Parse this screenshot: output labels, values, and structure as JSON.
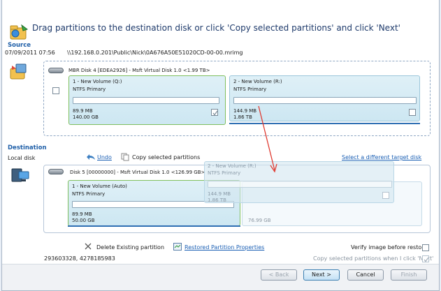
{
  "header": {
    "title": "Drag partitions to the destination disk or click 'Copy selected partitions' and click 'Next'"
  },
  "source": {
    "label": "Source",
    "date": "07/09/2011 07:56",
    "path": "\\\\192.168.0.201\\Public\\Nick\\0A676A50E51020CD-00-00.mrimg",
    "disk_info": "MBR Disk 4 [EDEA2926] - Msft     Virtual Disk     1.0   <1.99 TB>",
    "partitions": [
      {
        "name": "1 - New Volume (Q:)",
        "type": "NTFS Primary",
        "used": "89.9 MB",
        "total": "140.00 GB",
        "checked": true
      },
      {
        "name": "2 - New Volume (R:)",
        "type": "NTFS Primary",
        "used": "144.9 MB",
        "total": "1.86 TB",
        "checked": false
      }
    ]
  },
  "destination": {
    "label": "Destination",
    "local": "Local disk",
    "undo": "Undo",
    "copy": "Copy selected partitions",
    "select_target": "Select a different target disk",
    "disk_info": "Disk 5 [00000000] - Msft     Virtual Disk     1.0   <126.99 GB>",
    "partition": {
      "name": "1 - New Volume (Auto)",
      "type": "NTFS Primary",
      "used": "89.9 MB",
      "total": "50.00 GB"
    },
    "free": "76.99 GB",
    "ghost": {
      "name": "2 - New Volume (R:)",
      "type": "NTFS Primary",
      "used": "144.9 MB",
      "total": "1.86 TB"
    }
  },
  "actions": {
    "delete": "Delete Existing partition",
    "restored_props": "Restored Partition Properties",
    "verify": "Verify image before restore",
    "copy_when_next": "Copy selected partitions when I click 'Next'",
    "ids": "293603328, 4278185983"
  },
  "buttons": {
    "back": "< Back",
    "next": "Next >",
    "cancel": "Cancel",
    "finish": "Finish"
  },
  "colors": {
    "accent": "#2f6fb3",
    "link": "#1a5fb4",
    "selected_border": "#7fbf5f",
    "arrow": "#e0392f"
  }
}
